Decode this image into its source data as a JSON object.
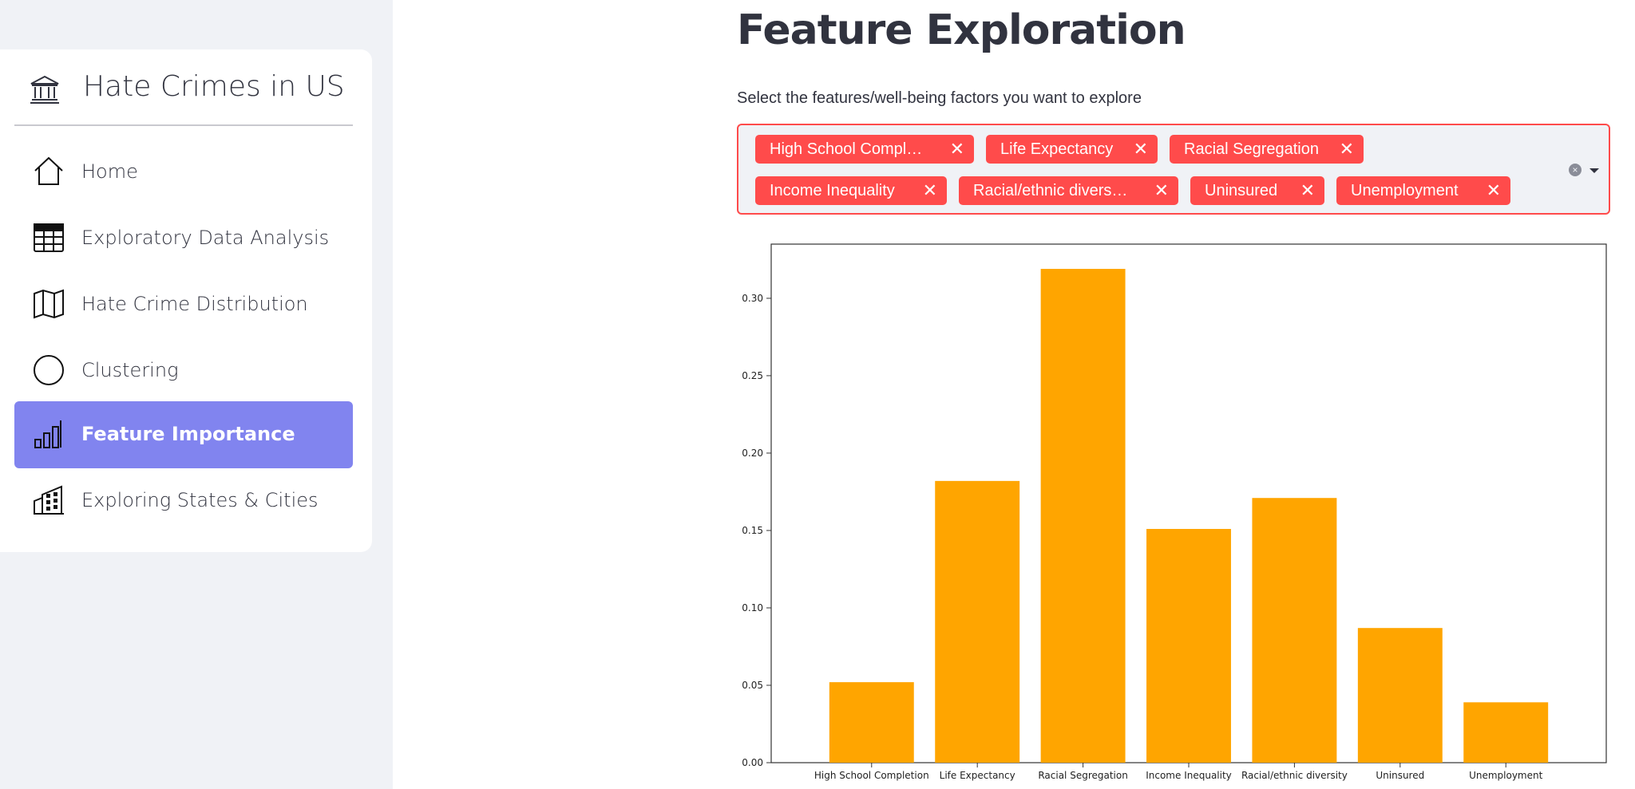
{
  "sidebar": {
    "brand_title": "Hate Crimes in US",
    "items": [
      {
        "label": "Home",
        "icon": "house-icon",
        "active": false
      },
      {
        "label": "Exploratory Data Analysis",
        "icon": "table-icon",
        "active": false
      },
      {
        "label": "Hate Crime Distribution",
        "icon": "map-icon",
        "active": false
      },
      {
        "label": "Clustering",
        "icon": "circle-icon",
        "active": false
      },
      {
        "label": "Feature Importance",
        "icon": "bar-chart-icon",
        "active": true
      },
      {
        "label": "Exploring States & Cities",
        "icon": "buildings-icon",
        "active": false
      }
    ],
    "colors": {
      "active_bg": "#8184ef",
      "panel_bg": "#ffffff",
      "sidebar_bg": "#f0f2f6"
    }
  },
  "main": {
    "title": "Feature Exploration",
    "select_label": "Select the features/well-being factors you want to explore",
    "chips": [
      {
        "label": "High School Compl…"
      },
      {
        "label": "Life Expectancy"
      },
      {
        "label": "Racial Segregation"
      },
      {
        "label": "Income Inequality"
      },
      {
        "label": "Racial/ethnic divers…"
      },
      {
        "label": "Uninsured"
      },
      {
        "label": "Unemployment"
      }
    ],
    "chip_close_glyph": "✕",
    "clear_glyph": "×",
    "colors": {
      "chip_bg": "#ff4b4b",
      "select_border": "#ff4b4b"
    }
  },
  "chart_data": {
    "type": "bar",
    "categories": [
      "High School Completion",
      "Life Expectancy",
      "Racial Segregation",
      "Income Inequality",
      "Racial/ethnic diversity",
      "Uninsured",
      "Unemployment"
    ],
    "values": [
      0.052,
      0.182,
      0.319,
      0.151,
      0.171,
      0.087,
      0.039
    ],
    "yticks": [
      0.0,
      0.05,
      0.1,
      0.15,
      0.2,
      0.25,
      0.3
    ],
    "ylim": [
      0,
      0.335
    ],
    "title": "",
    "xlabel": "",
    "ylabel": "",
    "grid": false,
    "bar_color": "#ffa500"
  }
}
